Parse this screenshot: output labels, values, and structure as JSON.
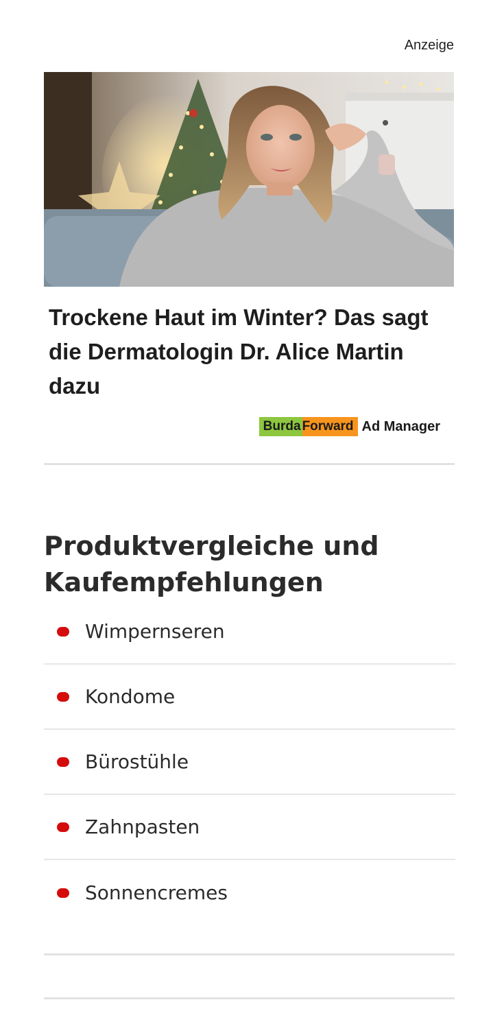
{
  "ad": {
    "label": "Anzeige",
    "headline": "Trockene Haut im Winter? Das sagt die Dermatologin Dr. Alice Martin dazu",
    "sponsor": {
      "badge_part1": "Burda",
      "badge_part2": "Forward",
      "text": "Ad Manager"
    },
    "colors": {
      "badge_green": "#8dc63f",
      "badge_orange": "#f7941d"
    }
  },
  "section": {
    "title": "Produktvergleiche und Kaufempfehlungen",
    "items": [
      {
        "label": "Wimpernseren"
      },
      {
        "label": "Kondome"
      },
      {
        "label": "Bürostühle"
      },
      {
        "label": "Zahnpasten"
      },
      {
        "label": "Sonnencremes"
      }
    ],
    "bullet_color": "#d50c0c"
  }
}
